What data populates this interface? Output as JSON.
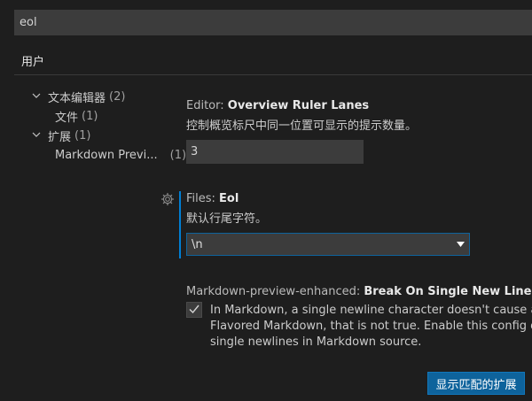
{
  "search": {
    "value": "eol"
  },
  "tabs": {
    "user": "用户"
  },
  "toc": {
    "items": [
      {
        "label": "文本编辑器",
        "count": "(2)",
        "expanded": true
      },
      {
        "label": "文件",
        "count": "(1)"
      },
      {
        "label": "扩展",
        "count": "(1)",
        "expanded": true
      },
      {
        "label": "Markdown Previ...",
        "count": "(1)"
      }
    ]
  },
  "settings": {
    "lanes": {
      "category": "Editor: ",
      "name": "Overview Ruler Lanes",
      "description": "控制概览标尺中同一位置可显示的提示数量。",
      "value": "3"
    },
    "eol": {
      "category": "Files: ",
      "name": "Eol",
      "description": "默认行尾字符。",
      "value": "\\n"
    },
    "mpe": {
      "category": "Markdown-preview-enhanced: ",
      "name": "Break On Single New Line",
      "checked": true,
      "description_lines": [
        "In Markdown, a single newline character doesn't cause a line break in the generated HTML. In GitHub",
        "Flavored Markdown, that is not true. Enable this config option to insert line breaks in rendered HTML for",
        "single newlines in Markdown source."
      ]
    }
  },
  "footer": {
    "show_extensions_label": "显示匹配的扩展"
  },
  "colors": {
    "accent": "#007fd4",
    "button": "#0e639c",
    "background": "#1e1e1e"
  },
  "icons": {
    "gear": "gear-icon",
    "chevron": "chevron-down-icon",
    "check": "check-icon"
  }
}
